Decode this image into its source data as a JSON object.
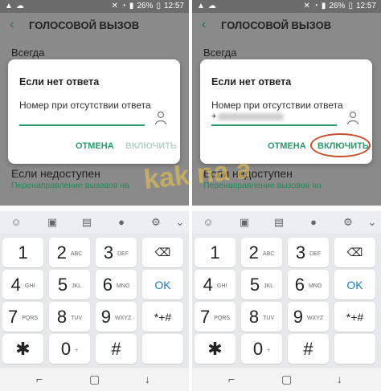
{
  "screens": [
    {
      "status": {
        "battery": "26%",
        "time": "12:57"
      },
      "appbar": {
        "title": "ГОЛОСОВОЙ ВЫЗОВ"
      },
      "settings": {
        "always": "Всегда",
        "unreachable": "Если недоступен",
        "unreachable_sub": "Перенаправление вызовов на"
      },
      "dialog": {
        "title": "Если нет ответа",
        "field_label": "Номер при отсутствии ответа",
        "field_value": "",
        "cancel": "ОТМЕНА",
        "enable": "ВКЛЮЧИТЬ"
      }
    },
    {
      "status": {
        "battery": "26%",
        "time": "12:57"
      },
      "appbar": {
        "title": "ГОЛОСОВОЙ ВЫЗОВ"
      },
      "settings": {
        "always": "Всегда",
        "unreachable": "Если недоступен",
        "unreachable_sub": "Перенаправление вызовов на"
      },
      "dialog": {
        "title": "Если нет ответа",
        "field_label": "Номер при отсутствии ответа",
        "field_value": "+",
        "cancel": "ОТМЕНА",
        "enable": "ВКЛЮЧИТЬ"
      }
    }
  ],
  "keyboard": {
    "keys": [
      {
        "num": "1",
        "letters": ""
      },
      {
        "num": "2",
        "letters": "ABC"
      },
      {
        "num": "3",
        "letters": "DEF"
      },
      {
        "num": "4",
        "letters": "GHI"
      },
      {
        "num": "5",
        "letters": "JKL"
      },
      {
        "num": "6",
        "letters": "MNO"
      },
      {
        "num": "7",
        "letters": "PQRS"
      },
      {
        "num": "8",
        "letters": "TUV"
      },
      {
        "num": "9",
        "letters": "WXYZ"
      },
      {
        "num": "0",
        "letters": "+"
      }
    ],
    "ok": "OK",
    "sym1": "*+#",
    "sym2": "✱",
    "sym3": ""
  },
  "watermark": "kak na android"
}
